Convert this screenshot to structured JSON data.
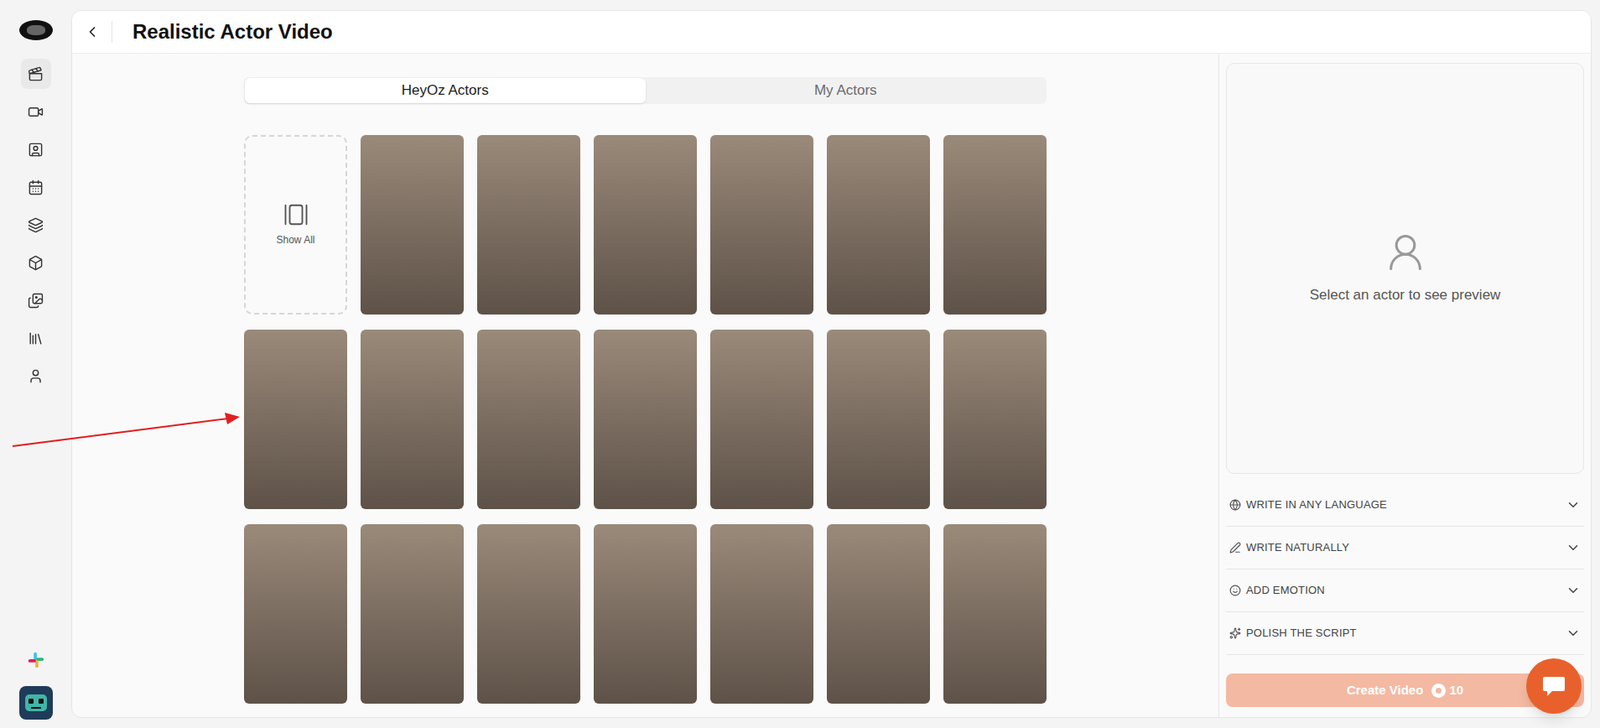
{
  "sidebar": {
    "items": [
      {
        "selected": true
      },
      {
        "selected": false
      },
      {
        "selected": false
      },
      {
        "selected": false
      },
      {
        "selected": false
      },
      {
        "selected": false
      },
      {
        "selected": false
      },
      {
        "selected": false
      },
      {
        "selected": false
      }
    ]
  },
  "header": {
    "title": "Realistic Actor Video"
  },
  "tabs": [
    {
      "label": "HeyOz Actors",
      "selected": true
    },
    {
      "label": "My Actors",
      "selected": false
    }
  ],
  "grid": {
    "show_all": "Show All",
    "actors": [
      {
        "selected": false
      },
      {
        "selected": false
      },
      {
        "selected": false
      },
      {
        "selected": false
      },
      {
        "selected": false
      },
      {
        "selected": false
      },
      {
        "selected": false
      },
      {
        "selected": false
      },
      {
        "selected": false
      },
      {
        "selected": false
      },
      {
        "selected": false
      },
      {
        "selected": false
      },
      {
        "selected": false
      },
      {
        "selected": false
      },
      {
        "selected": false
      },
      {
        "selected": false
      },
      {
        "selected": false
      },
      {
        "selected": false
      },
      {
        "selected": false
      },
      {
        "selected": false
      }
    ]
  },
  "preview": {
    "placeholder": "Select an actor to see preview"
  },
  "accordions": [
    {
      "label": "WRITE IN ANY LANGUAGE",
      "expanded": false
    },
    {
      "label": "WRITE NATURALLY",
      "expanded": false
    },
    {
      "label": "ADD EMOTION",
      "expanded": false
    },
    {
      "label": "POLISH THE SCRIPT",
      "expanded": false
    }
  ],
  "create_button": {
    "label": "Create Video",
    "cost": "10",
    "disabled": true
  }
}
